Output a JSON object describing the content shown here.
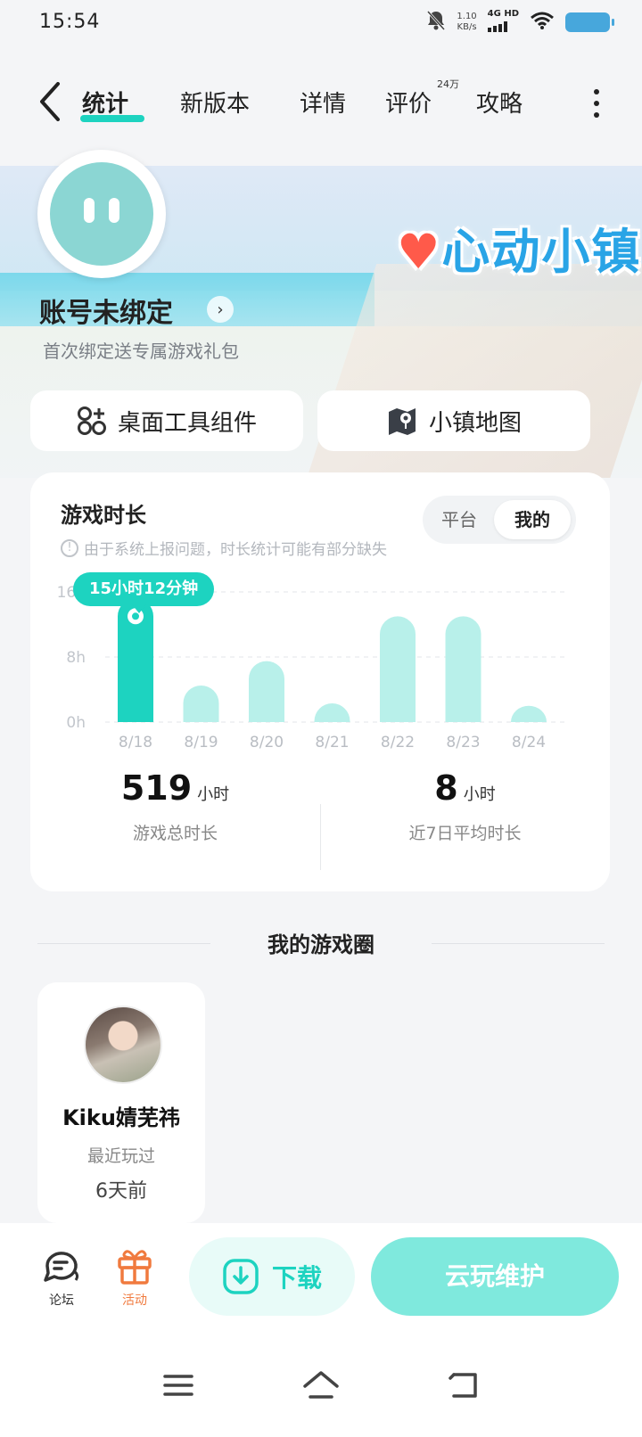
{
  "status_bar": {
    "time": "15:54",
    "net_speed_value": "1.10",
    "net_speed_unit": "KB/s",
    "network_type": "4G HD"
  },
  "nav": {
    "tabs": [
      {
        "label": "统计",
        "active": true
      },
      {
        "label": "新版本",
        "active": false
      },
      {
        "label": "详情",
        "active": false
      },
      {
        "label": "评价",
        "active": false
      },
      {
        "label": "攻略",
        "active": false
      }
    ],
    "review_badge": "24万"
  },
  "banner": {
    "game_logo": "心动小镇",
    "account_title": "账号未绑定",
    "account_subtitle": "首次绑定送专属游戏礼包"
  },
  "tools": {
    "widget_label": "桌面工具组件",
    "map_label": "小镇地图"
  },
  "stats": {
    "title": "游戏时长",
    "toggle": {
      "platform": "平台",
      "mine": "我的",
      "selected": "mine"
    },
    "notice": "由于系统上报问题，时长统计可能有部分缺失",
    "tooltip": "15小时12分钟",
    "total_value": "519",
    "total_unit": "小时",
    "total_label": "游戏总时长",
    "avg_value": "8",
    "avg_unit": "小时",
    "avg_label": "近7日平均时长"
  },
  "chart_data": {
    "type": "bar",
    "categories": [
      "8/18",
      "8/19",
      "8/20",
      "8/21",
      "8/22",
      "8/23",
      "8/24"
    ],
    "values": [
      15.2,
      4.5,
      7.5,
      2.3,
      13.0,
      13.0,
      2.0
    ],
    "y_ticks": [
      "0h",
      "8h",
      "16h"
    ],
    "ylim": [
      0,
      16
    ],
    "highlight_index": 0,
    "colors": {
      "highlight": "#1dd3c0",
      "normal": "#b8f0ea"
    },
    "grid": true
  },
  "circle": {
    "heading": "我的游戏圈",
    "friend": {
      "name": "Kiku婧芜祎",
      "status": "最近玩过",
      "time": "6天前"
    }
  },
  "bottom_bar": {
    "forum_label": "论坛",
    "activity_label": "活动",
    "download_label": "下载",
    "cloud_label": "云玩维护",
    "colors": {
      "accent": "#1dd3c0",
      "activity": "#f07a3e"
    }
  }
}
